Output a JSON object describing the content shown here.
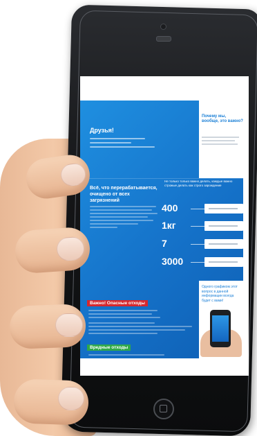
{
  "screen": {
    "friends_title": "Друзья!",
    "side_question": "Почему мы, вообще, это важно?",
    "main_heading": "Всё, что перерабатывается, очищено от всех загрязнений",
    "stats_intro": "Не только только важно делать, каждые важно строжые делать как строго зарождение",
    "stats": [
      {
        "value": "400"
      },
      {
        "value": "1кг"
      },
      {
        "value": "7"
      },
      {
        "value": "3000"
      }
    ],
    "bottom_question": "Одного графиком этот вопрос в данной информации всегда будет с вами!",
    "red_label": "Важно! Опасные отходы",
    "green_label": "Вредные отходы"
  },
  "colors": {
    "screen_blue": "#1572c9",
    "accent_red": "#d6282e",
    "accent_green": "#2fa84a",
    "phone_body": "#141517",
    "skin": "#f3c9a8"
  },
  "icons": [
    "home-button-icon",
    "speaker-icon",
    "camera-icon"
  ]
}
